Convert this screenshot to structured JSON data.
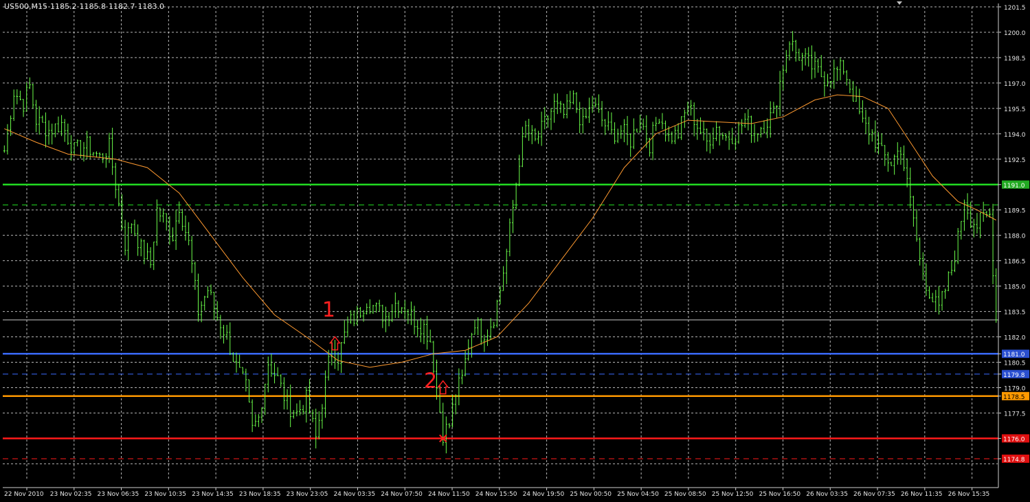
{
  "header": {
    "symbol": "US500,M15",
    "open": "1185.2",
    "high": "1185.8",
    "low": "1182.7",
    "close": "1183.0"
  },
  "colors": {
    "background": "#000000",
    "grid": "#d8d8d8",
    "candle": "#6cff4a",
    "moving_average": "#ff9a30",
    "green_level": "#22dd22",
    "blue_level": "#3b6cff",
    "orange_level": "#ff9900",
    "red_level": "#ff1a1a",
    "white_level": "#c8c8c8",
    "annotation": "#ff2020"
  },
  "chart_data": {
    "type": "candlestick",
    "title": "",
    "xlabel": "",
    "ylabel": "",
    "ylim": [
      1173.5,
      1201.5
    ],
    "grid": true,
    "y_ticks": [
      "1201.5",
      "1200.0",
      "1198.5",
      "1197.0",
      "1195.5",
      "1194.0",
      "1192.5",
      "1191.0",
      "1189.5",
      "1188.0",
      "1186.5",
      "1185.0",
      "1183.5",
      "1182.0",
      "1181.0",
      "1180.5",
      "1179.8",
      "1179.0",
      "1178.5",
      "1177.5",
      "1176.0",
      "1174.8"
    ],
    "x_ticks": [
      "22 Nov 2010",
      "23 Nov 02:35",
      "23 Nov 06:35",
      "23 Nov 10:35",
      "23 Nov 14:35",
      "23 Nov 18:35",
      "23 Nov 23:05",
      "24 Nov 03:35",
      "24 Nov 07:50",
      "24 Nov 11:50",
      "24 Nov 15:50",
      "24 Nov 19:50",
      "25 Nov 00:50",
      "25 Nov 04:50",
      "25 Nov 08:50",
      "25 Nov 12:50",
      "25 Nov 16:50",
      "26 Nov 03:35",
      "26 Nov 07:35",
      "26 Nov 11:35",
      "26 Nov 15:35"
    ],
    "price_path": [
      [
        0,
        1193.0
      ],
      [
        3,
        1196.5
      ],
      [
        6,
        1195.8
      ],
      [
        8,
        1196.8
      ],
      [
        10,
        1194.8
      ],
      [
        14,
        1194.2
      ],
      [
        18,
        1194.6
      ],
      [
        22,
        1193.0
      ],
      [
        26,
        1193.3
      ],
      [
        30,
        1192.6
      ],
      [
        33,
        1193.2
      ],
      [
        35,
        1191.0
      ],
      [
        38,
        1187.5
      ],
      [
        40,
        1188.8
      ],
      [
        43,
        1187.2
      ],
      [
        46,
        1186.3
      ],
      [
        48,
        1189.5
      ],
      [
        50,
        1189.0
      ],
      [
        53,
        1188.0
      ],
      [
        55,
        1189.8
      ],
      [
        58,
        1187.5
      ],
      [
        61,
        1183.5
      ],
      [
        64,
        1184.8
      ],
      [
        67,
        1183.2
      ],
      [
        70,
        1182.0
      ],
      [
        73,
        1180.2
      ],
      [
        76,
        1179.0
      ],
      [
        78,
        1176.5
      ],
      [
        80,
        1177.2
      ],
      [
        83,
        1180.5
      ],
      [
        86,
        1179.5
      ],
      [
        89,
        1178.0
      ],
      [
        92,
        1177.5
      ],
      [
        95,
        1178.3
      ],
      [
        98,
        1176.0
      ],
      [
        100,
        1178.2
      ],
      [
        103,
        1181.5
      ],
      [
        105,
        1180.8
      ],
      [
        108,
        1182.7
      ],
      [
        111,
        1183.3
      ],
      [
        114,
        1184.2
      ],
      [
        117,
        1183.6
      ],
      [
        120,
        1183.2
      ],
      [
        123,
        1184.0
      ],
      [
        126,
        1183.8
      ],
      [
        129,
        1183.0
      ],
      [
        132,
        1182.6
      ],
      [
        134,
        1181.8
      ],
      [
        136,
        1179.0
      ],
      [
        138,
        1176.3
      ],
      [
        140,
        1176.8
      ],
      [
        142,
        1178.7
      ],
      [
        144,
        1179.5
      ],
      [
        146,
        1181.6
      ],
      [
        148,
        1183.0
      ],
      [
        150,
        1182.2
      ],
      [
        152,
        1182.4
      ],
      [
        154,
        1183.2
      ],
      [
        156,
        1184.8
      ],
      [
        158,
        1187.0
      ],
      [
        160,
        1189.6
      ],
      [
        162,
        1192.5
      ],
      [
        164,
        1194.3
      ],
      [
        167,
        1193.5
      ],
      [
        170,
        1194.6
      ],
      [
        173,
        1195.7
      ],
      [
        176,
        1195.1
      ],
      [
        179,
        1196.0
      ],
      [
        182,
        1194.5
      ],
      [
        185,
        1195.8
      ],
      [
        188,
        1194.8
      ],
      [
        191,
        1194.0
      ],
      [
        194,
        1194.2
      ],
      [
        197,
        1193.6
      ],
      [
        200,
        1194.9
      ],
      [
        203,
        1193.4
      ],
      [
        206,
        1195.2
      ],
      [
        209,
        1193.8
      ],
      [
        212,
        1194.0
      ],
      [
        215,
        1195.7
      ],
      [
        218,
        1194.5
      ],
      [
        221,
        1193.5
      ],
      [
        224,
        1194.4
      ],
      [
        227,
        1193.8
      ],
      [
        230,
        1194.0
      ],
      [
        233,
        1194.8
      ],
      [
        236,
        1194.1
      ],
      [
        239,
        1194.6
      ],
      [
        242,
        1195.2
      ],
      [
        245,
        1198.0
      ],
      [
        247,
        1199.6
      ],
      [
        249,
        1198.8
      ],
      [
        252,
        1198.3
      ],
      [
        255,
        1197.8
      ],
      [
        258,
        1197.3
      ],
      [
        261,
        1197.6
      ],
      [
        264,
        1197.9
      ],
      [
        267,
        1196.3
      ],
      [
        270,
        1194.6
      ],
      [
        273,
        1194.0
      ],
      [
        276,
        1192.8
      ],
      [
        279,
        1192.3
      ],
      [
        282,
        1193.2
      ],
      [
        284,
        1191.0
      ],
      [
        286,
        1189.0
      ],
      [
        288,
        1186.5
      ],
      [
        290,
        1185.2
      ],
      [
        292,
        1184.2
      ],
      [
        294,
        1183.6
      ],
      [
        296,
        1184.8
      ],
      [
        298,
        1186.0
      ],
      [
        300,
        1187.8
      ],
      [
        302,
        1190.2
      ],
      [
        304,
        1189.0
      ],
      [
        306,
        1188.6
      ],
      [
        308,
        1189.0
      ],
      [
        310,
        1189.2
      ],
      [
        312,
        1183.0
      ]
    ],
    "moving_average": [
      [
        0,
        1194.3
      ],
      [
        10,
        1193.5
      ],
      [
        20,
        1192.8
      ],
      [
        35,
        1192.5
      ],
      [
        45,
        1192.0
      ],
      [
        55,
        1190.5
      ],
      [
        65,
        1188.0
      ],
      [
        75,
        1185.5
      ],
      [
        85,
        1183.3
      ],
      [
        95,
        1182.0
      ],
      [
        105,
        1180.6
      ],
      [
        115,
        1180.2
      ],
      [
        125,
        1180.5
      ],
      [
        135,
        1181.0
      ],
      [
        145,
        1181.2
      ],
      [
        155,
        1182.0
      ],
      [
        165,
        1184.0
      ],
      [
        175,
        1186.5
      ],
      [
        185,
        1189.0
      ],
      [
        195,
        1192.0
      ],
      [
        205,
        1194.0
      ],
      [
        215,
        1194.8
      ],
      [
        225,
        1194.7
      ],
      [
        235,
        1194.6
      ],
      [
        245,
        1195.0
      ],
      [
        255,
        1196.0
      ],
      [
        262,
        1196.3
      ],
      [
        270,
        1196.2
      ],
      [
        278,
        1195.5
      ],
      [
        285,
        1193.5
      ],
      [
        292,
        1191.5
      ],
      [
        300,
        1190.0
      ],
      [
        306,
        1189.5
      ],
      [
        312,
        1188.9
      ]
    ],
    "levels": [
      {
        "price": 1191.0,
        "label": "1191.0",
        "style": "solid",
        "color_key": "green_level",
        "label_bg": "#22aa22"
      },
      {
        "price": 1189.8,
        "label": "1189.8",
        "style": "dashed",
        "color_key": "green_level",
        "label_bg": "#22aa22"
      },
      {
        "price": 1183.0,
        "label": "1183.0",
        "style": "solid",
        "color_key": "white_level",
        "label_bg": "#000000"
      },
      {
        "price": 1181.0,
        "label": "1181.0",
        "style": "solid",
        "color_key": "blue_level",
        "label_bg": "#2a4fd0"
      },
      {
        "price": 1179.8,
        "label": "1179.8",
        "style": "dashed",
        "color_key": "blue_level",
        "label_bg": "#2a4fd0"
      },
      {
        "price": 1178.5,
        "label": "1178.5",
        "style": "solid",
        "color_key": "orange_level",
        "label_bg": "#ff9900"
      },
      {
        "price": 1176.0,
        "label": "1176.0",
        "style": "solid",
        "color_key": "red_level",
        "label_bg": "#e01010"
      },
      {
        "price": 1174.8,
        "label": "1174.8",
        "style": "dashed",
        "color_key": "red_level",
        "label_bg": "#e01010"
      }
    ],
    "annotations": [
      {
        "text": "1",
        "bar": 100,
        "price": 1183.2
      },
      {
        "text": "2",
        "bar": 132,
        "price": 1179.0
      }
    ],
    "arrows": [
      {
        "bar": 104,
        "price": 1181.8
      },
      {
        "bar": 138,
        "price": 1179.2
      }
    ],
    "cross_marker": {
      "bar": 138,
      "price": 1176.0
    }
  }
}
